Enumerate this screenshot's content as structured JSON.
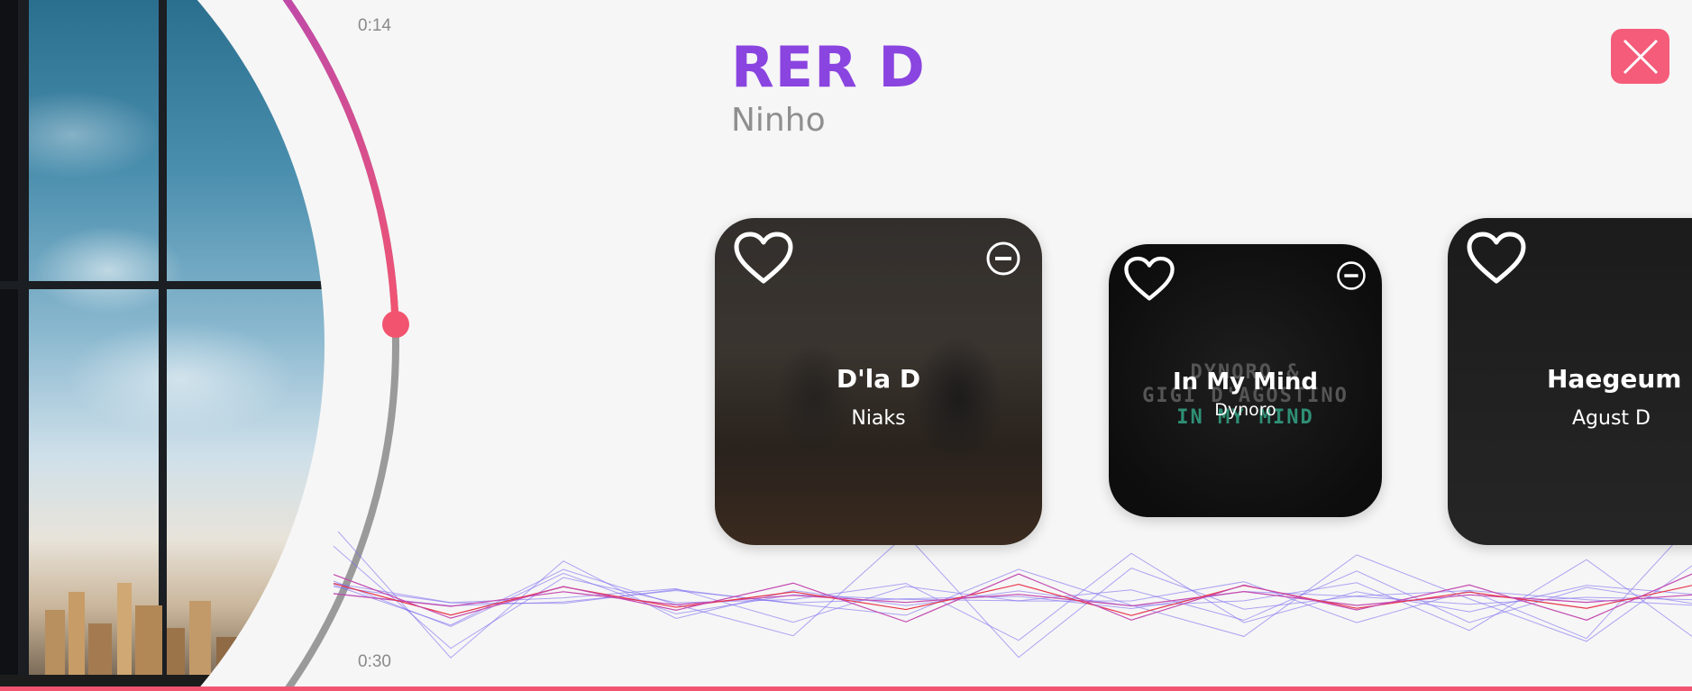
{
  "player": {
    "time_elapsed": "0:14",
    "time_total": "0:30",
    "progress_fraction": 0.47
  },
  "now_playing": {
    "title": "RER D",
    "artist": "Ninho"
  },
  "cards": [
    {
      "title": "D'la D",
      "artist": "Niaks"
    },
    {
      "title": "In My Mind",
      "artist": "Dynoro",
      "cover_text": [
        "DYNORO &",
        "GIGI D'AGOSTINO",
        "IN MY MIND"
      ]
    },
    {
      "title": "Haegeum",
      "artist": "Agust D"
    }
  ],
  "icons": {
    "close": "close-icon",
    "heart": "heart-icon",
    "remove": "minus-circle-icon"
  },
  "colors": {
    "accent_pink": "#f2546f",
    "title_purple": "#8a44e0",
    "close_button": "#f45c79",
    "wave_purple": "#7b6bf0",
    "wave_red": "#e8344a",
    "arc_gray": "#9a9a9a"
  }
}
